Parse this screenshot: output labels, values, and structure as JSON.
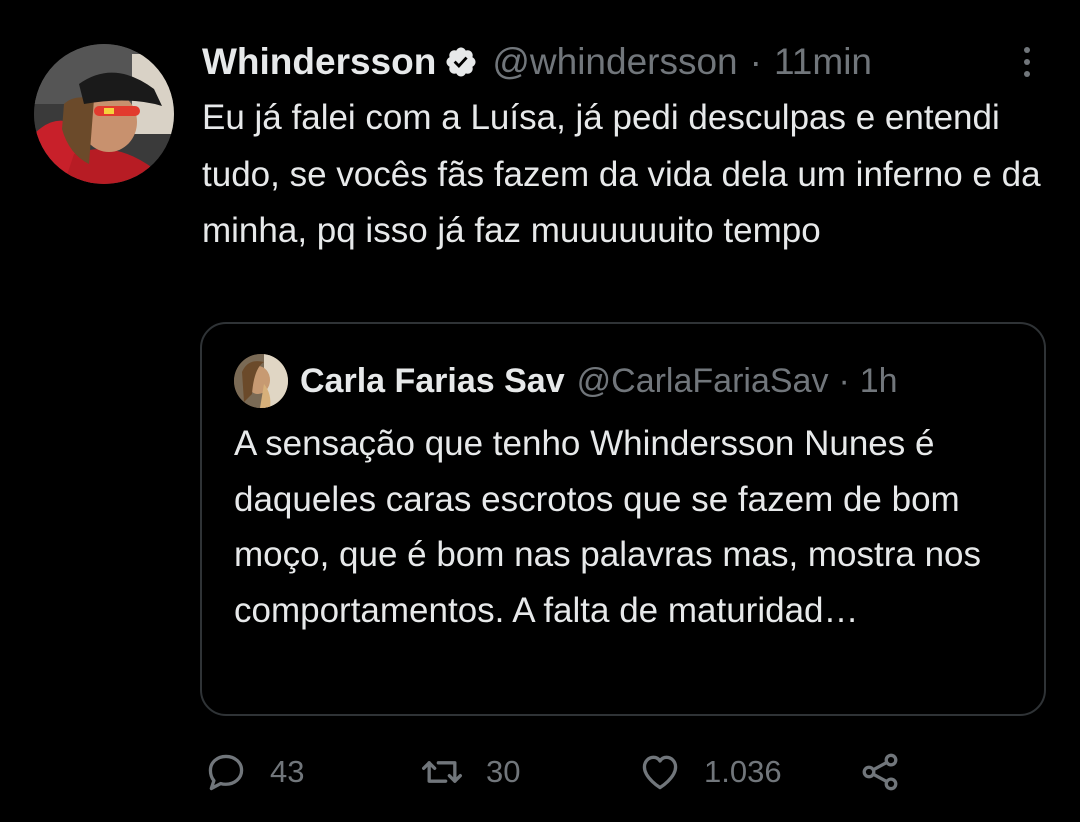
{
  "tweet": {
    "author": {
      "display_name": "Whindersson",
      "verified": true,
      "handle": "@whindersson",
      "avatar_icon": "user-avatar"
    },
    "separator": "·",
    "time": "11min",
    "text": "Eu já falei com a Luísa, já pedi desculpas e entendi tudo, se vocês fãs fazem da vida dela um inferno e da minha, pq isso já faz muuuuuuito tempo",
    "more_icon": "more-vertical-icon"
  },
  "quoted_tweet": {
    "author": {
      "display_name": "Carla Farias Sav",
      "handle": "@CarlaFariaSav",
      "avatar_icon": "user-avatar"
    },
    "separator": "·",
    "time": "1h",
    "text": "A sensação que tenho Whindersson Nunes é daqueles caras escrotos que se fazem de bom moço, que é bom nas palavras mas, mostra nos comportamentos. A falta de maturidad…"
  },
  "actions": {
    "reply": {
      "icon": "reply-icon",
      "count": "43"
    },
    "retweet": {
      "icon": "retweet-icon",
      "count": "30"
    },
    "like": {
      "icon": "heart-icon",
      "count": "1.036"
    },
    "share": {
      "icon": "share-icon"
    }
  },
  "colors": {
    "background": "#000000",
    "text_primary": "#e7e9ea",
    "text_secondary": "#71767b",
    "border": "#2f3336"
  }
}
